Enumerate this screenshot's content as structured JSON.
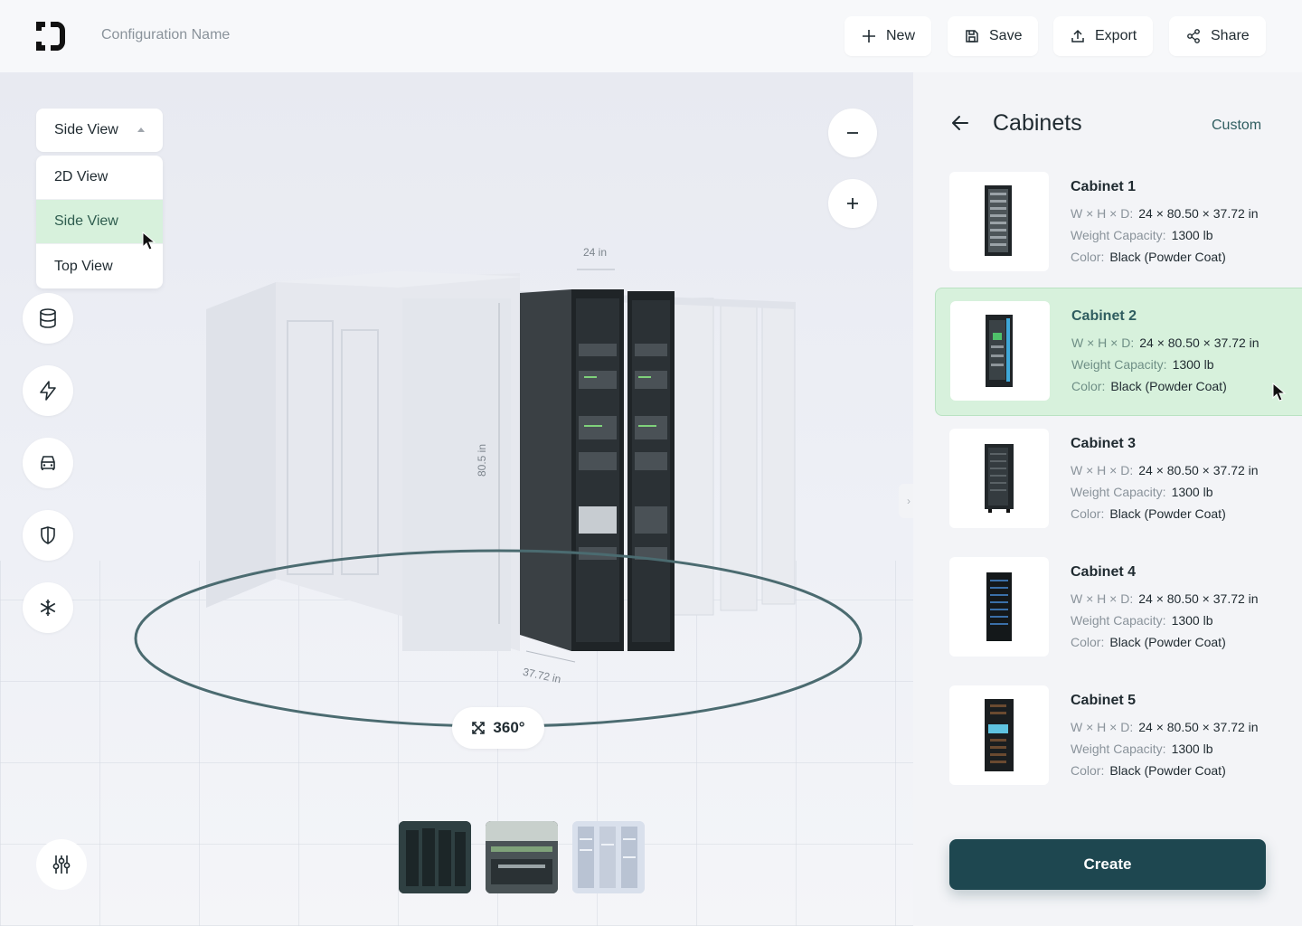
{
  "header": {
    "config_name": "Configuration Name",
    "buttons": {
      "new": "New",
      "save": "Save",
      "export": "Export",
      "share": "Share"
    }
  },
  "viewer": {
    "view_select": {
      "selected": "Side View",
      "options": [
        "2D View",
        "Side View",
        "Top View"
      ]
    },
    "tools": [
      "database-icon",
      "bolt-icon",
      "car-icon",
      "shield-icon",
      "snowflake-icon"
    ],
    "dimensions": {
      "width": "24 in",
      "height": "80.5 in",
      "depth": "37.72 in"
    },
    "rotate_label": "360°"
  },
  "panel": {
    "title": "Cabinets",
    "custom_link": "Custom",
    "spec_labels": {
      "dims": "W × H × D:",
      "weight": "Weight Capacity:",
      "color": "Color:"
    },
    "cabinets": [
      {
        "name": "Cabinet 1",
        "dims": "24 × 80.50 × 37.72 in",
        "weight": "1300 lb",
        "color": "Black (Powder Coat)"
      },
      {
        "name": "Cabinet 2",
        "dims": "24 × 80.50 × 37.72 in",
        "weight": "1300 lb",
        "color": "Black (Powder Coat)"
      },
      {
        "name": "Cabinet 3",
        "dims": "24 × 80.50 × 37.72 in",
        "weight": "1300 lb",
        "color": "Black (Powder Coat)"
      },
      {
        "name": "Cabinet 4",
        "dims": "24 × 80.50 × 37.72 in",
        "weight": "1300 lb",
        "color": "Black (Powder Coat)"
      },
      {
        "name": "Cabinet 5",
        "dims": "24 × 80.50 × 37.72 in",
        "weight": "1300 lb",
        "color": "Black (Powder Coat)"
      }
    ],
    "create_label": "Create"
  },
  "colors": {
    "accent": "#1e4750",
    "selected": "#d7f1dc",
    "selected_text": "#2f5d60"
  }
}
